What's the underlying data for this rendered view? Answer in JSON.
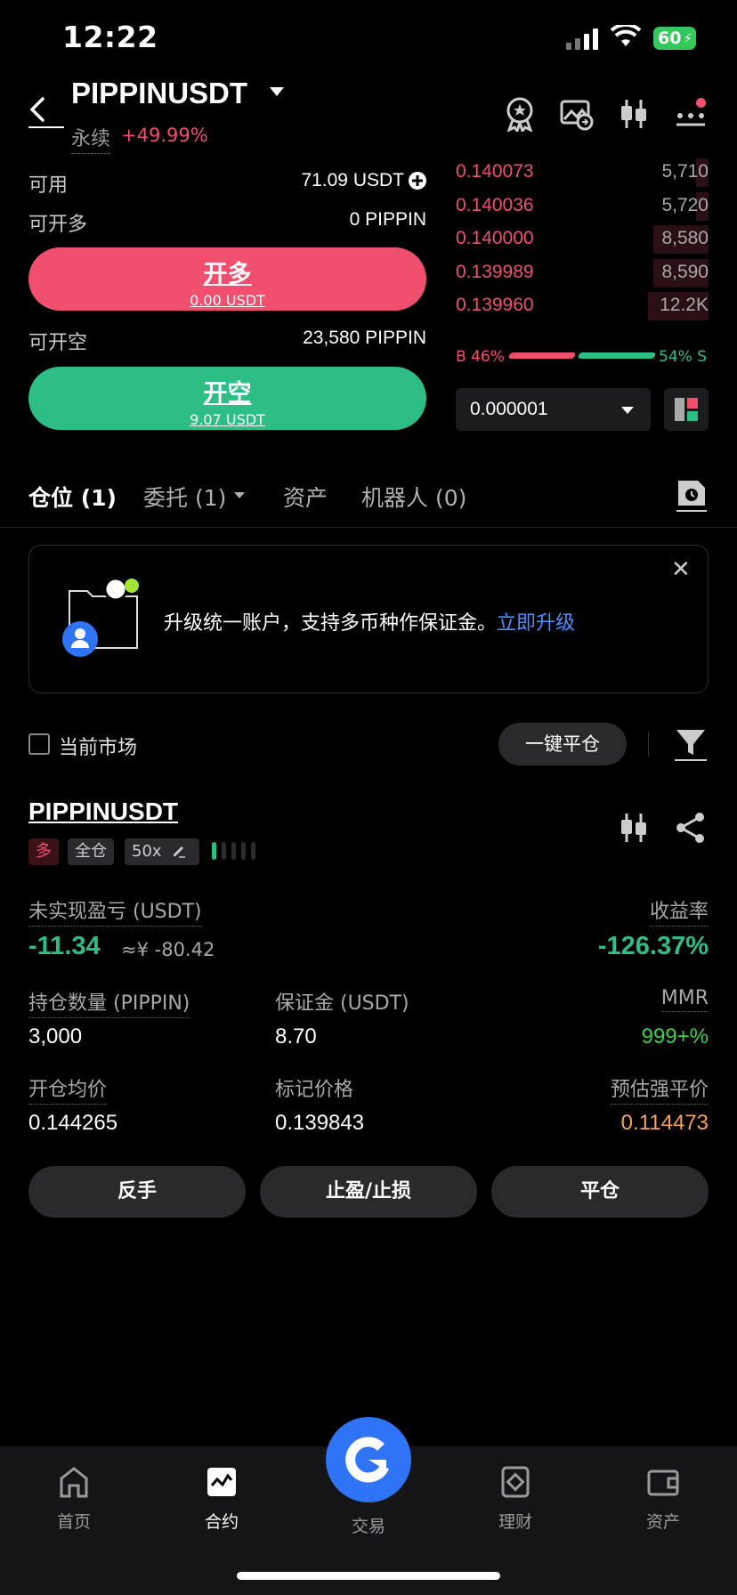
{
  "status_bar": {
    "time": "12:22",
    "battery": "60"
  },
  "header": {
    "symbol": "PIPPINUSDT",
    "contract_type": "永续",
    "change": "+49.99%"
  },
  "trade_panel": {
    "available_label": "可用",
    "available_value": "71.09 USDT",
    "max_long_label": "可开多",
    "max_long_value": "0 PIPPIN",
    "long_button": "开多",
    "long_cost": "0.00 USDT",
    "max_short_label": "可开空",
    "max_short_value": "23,580 PIPPIN",
    "short_button": "开空",
    "short_cost": "9.07 USDT"
  },
  "orderbook": {
    "asks": [
      {
        "price": "0.140073",
        "qty": "5,710",
        "depth": 0.05
      },
      {
        "price": "0.140036",
        "qty": "5,720",
        "depth": 0.05
      },
      {
        "price": "0.140000",
        "qty": "8,580",
        "depth": 0.22
      },
      {
        "price": "0.139989",
        "qty": "8,590",
        "depth": 0.22
      },
      {
        "price": "0.139960",
        "qty": "12.2K",
        "depth": 0.24
      }
    ],
    "buy_ratio": "B 46%",
    "sell_ratio": "54% S",
    "precision": "0.000001"
  },
  "tabs": [
    {
      "label": "仓位 (1)"
    },
    {
      "label": "委托 (1)"
    },
    {
      "label": "资产"
    },
    {
      "label": "机器人 (0)"
    }
  ],
  "banner": {
    "text": "升级统一账户，支持多币种作保证金。",
    "link": "立即升级"
  },
  "filter": {
    "current_market": "当前市场",
    "close_all": "一键平仓"
  },
  "position": {
    "symbol": "PIPPINUSDT",
    "side": "多",
    "margin_mode": "全仓",
    "leverage": "50x",
    "upnl_label": "未实现盈亏 (USDT)",
    "upnl_value": "-11.34",
    "upnl_cny": "≈¥ -80.42",
    "roe_label": "收益率",
    "roe_value": "-126.37%",
    "size_label": "持仓数量 (PIPPIN)",
    "size_value": "3,000",
    "margin_label": "保证金 (USDT)",
    "margin_value": "8.70",
    "mmr_label": "MMR",
    "mmr_value": "999+%",
    "entry_label": "开仓均价",
    "entry_value": "0.144265",
    "mark_label": "标记价格",
    "mark_value": "0.139843",
    "liq_label": "预估强平价",
    "liq_value": "0.114473",
    "actions": [
      "反手",
      "止盈/止损",
      "平仓"
    ]
  },
  "nav": [
    {
      "label": "首页"
    },
    {
      "label": "合约"
    },
    {
      "label": "交易"
    },
    {
      "label": "理财"
    },
    {
      "label": "资产"
    }
  ],
  "colors": {
    "red": "#f0506e",
    "green": "#2ebd85",
    "blue": "#2f74f5",
    "orange": "#f5a25d"
  }
}
